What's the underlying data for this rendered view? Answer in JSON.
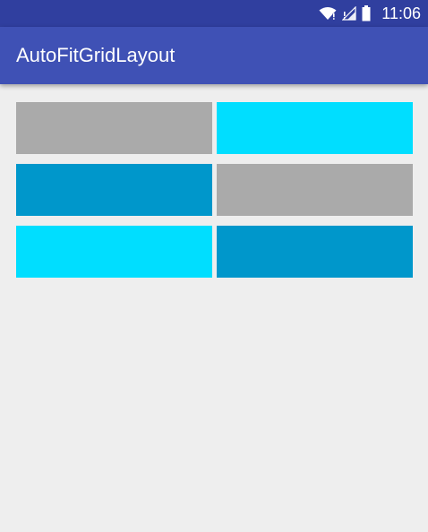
{
  "status_bar": {
    "time": "11:06",
    "icons": [
      "wifi-icon",
      "signal-icon",
      "battery-icon"
    ]
  },
  "app_bar": {
    "title": "AutoFitGridLayout"
  },
  "grid": {
    "columns": 2,
    "tiles": [
      {
        "color": "#aaaaaa"
      },
      {
        "color": "#00deff"
      },
      {
        "color": "#0097cb"
      },
      {
        "color": "#aaaaaa"
      },
      {
        "color": "#00deff"
      },
      {
        "color": "#0097cb"
      }
    ]
  },
  "colors": {
    "status_bar": "#303f9f",
    "app_bar": "#3f51b5",
    "background": "#eeeeee"
  }
}
